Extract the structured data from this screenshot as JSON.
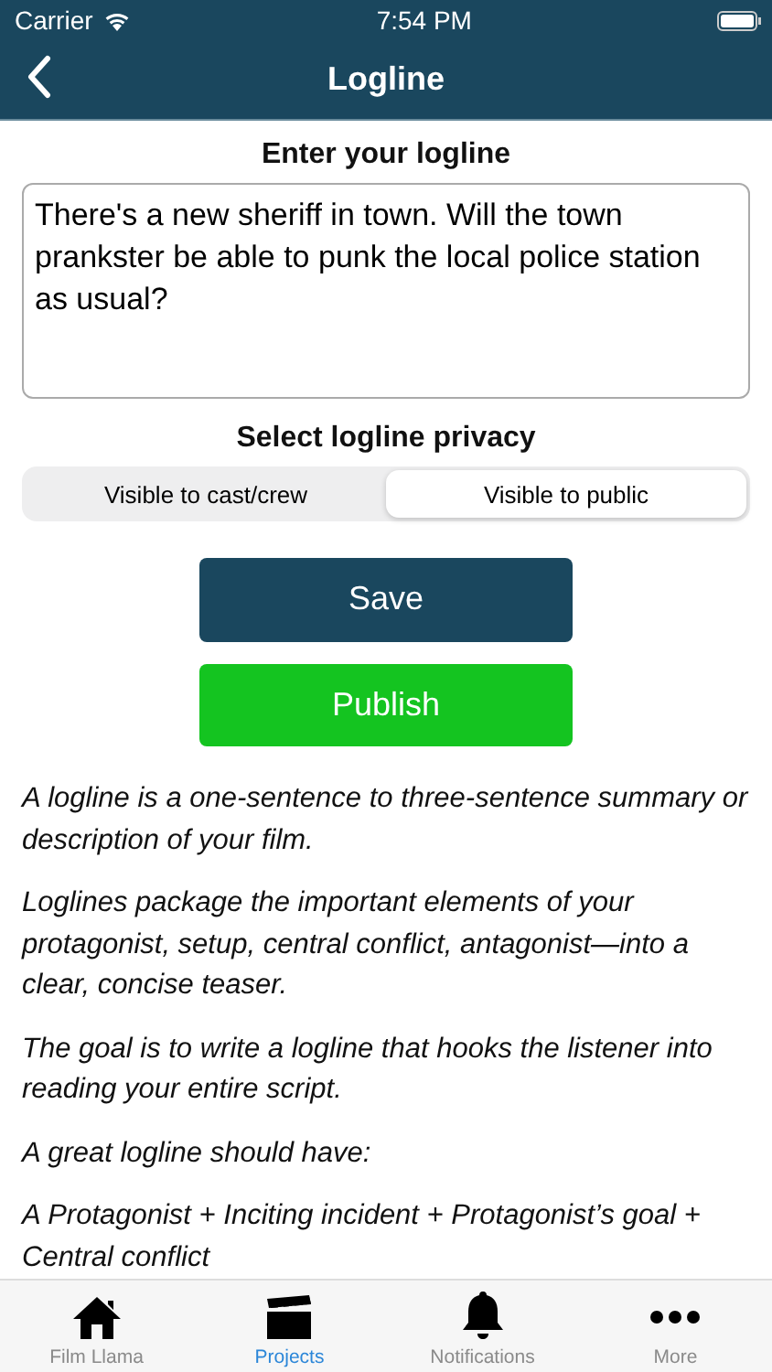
{
  "status_bar": {
    "carrier": "Carrier",
    "time": "7:54 PM"
  },
  "nav": {
    "title": "Logline"
  },
  "logline": {
    "label": "Enter your logline",
    "value": "There's a new sheriff in town. Will the town prankster be able to punk the local police station as usual?"
  },
  "privacy": {
    "label": "Select logline privacy",
    "options": [
      {
        "label": "Visible to cast/crew",
        "selected": false
      },
      {
        "label": "Visible to public",
        "selected": true
      }
    ]
  },
  "buttons": [
    {
      "label": "Save",
      "kind": "save"
    },
    {
      "label": "Publish",
      "kind": "publish"
    }
  ],
  "help": [
    "A logline is a one-sentence to three-sentence summary or description of your film.",
    "Loglines package the important elements of your protagonist, setup, central conflict, antagonist—into a clear, concise teaser.",
    "The goal is to write a logline that hooks the listener into reading your entire script.",
    "A great logline should have:",
    "A Protagonist + Inciting incident + Protagonist’s goal + Central conflict"
  ],
  "tabs": [
    {
      "label": "Film Llama",
      "kind": "home",
      "selected": false
    },
    {
      "label": "Projects",
      "kind": "clapper",
      "selected": true
    },
    {
      "label": "Notifications",
      "kind": "bell",
      "selected": false
    },
    {
      "label": "More",
      "kind": "more",
      "selected": false
    }
  ]
}
